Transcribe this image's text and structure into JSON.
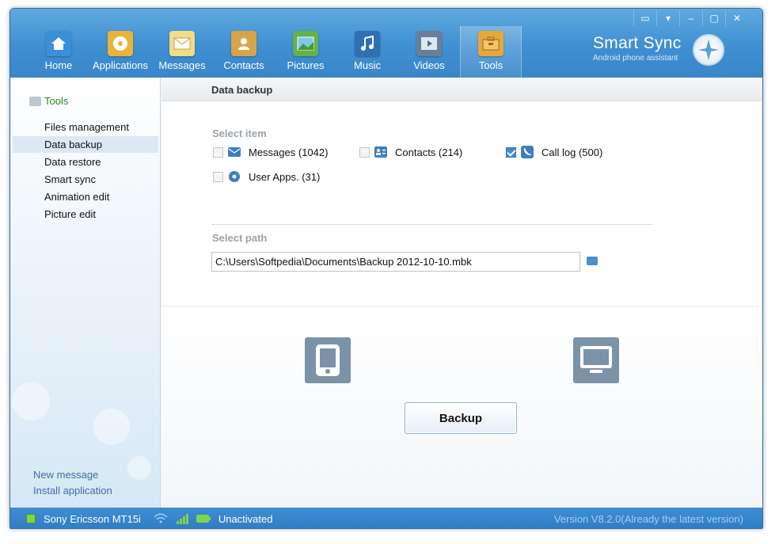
{
  "window": {
    "controls": [
      "message-icon",
      "menu-icon",
      "minimize-icon",
      "maximize-icon",
      "close-icon"
    ]
  },
  "nav": {
    "items": [
      {
        "label": "Home",
        "icon": "home-icon",
        "color": "#3a8fd6"
      },
      {
        "label": "Applications",
        "icon": "applications-icon",
        "color": "#e9b43a"
      },
      {
        "label": "Messages",
        "icon": "messages-icon",
        "color": "#f1dc8a"
      },
      {
        "label": "Contacts",
        "icon": "contacts-icon",
        "color": "#d9a34a"
      },
      {
        "label": "Pictures",
        "icon": "pictures-icon",
        "color": "#63b24a"
      },
      {
        "label": "Music",
        "icon": "music-icon",
        "color": "#2f6fb4"
      },
      {
        "label": "Videos",
        "icon": "videos-icon",
        "color": "#6a7f95"
      },
      {
        "label": "Tools",
        "icon": "tools-icon",
        "color": "#e6a83a"
      }
    ],
    "active": "Tools"
  },
  "brand": {
    "title": "Smart Sync",
    "subtitle": "Android phone assistant"
  },
  "sidebar": {
    "root": "Tools",
    "items": [
      "Files management",
      "Data backup",
      "Data restore",
      "Smart sync",
      "Animation edit",
      "Picture edit"
    ],
    "selected": "Data backup",
    "links": [
      "New message",
      "Install application"
    ]
  },
  "main": {
    "header": "Data backup",
    "select_item_label": "Select item",
    "options": [
      {
        "label": "Messages (1042)",
        "checked": false,
        "icon": "envelope-icon"
      },
      {
        "label": "Contacts (214)",
        "checked": false,
        "icon": "contact-card-icon"
      },
      {
        "label": "Call log (500)",
        "checked": true,
        "icon": "phone-icon"
      },
      {
        "label": "User  Apps. (31)",
        "checked": false,
        "icon": "app-disc-icon"
      }
    ],
    "select_path_label": "Select path",
    "path_value": "C:\\Users\\Softpedia\\Documents\\Backup 2012-10-10.mbk",
    "backup_label": "Backup"
  },
  "status": {
    "device": "Sony Ericsson MT15i",
    "activation": "Unactivated",
    "version": "Version V8.2.0(Already the latest version)"
  },
  "colors": {
    "accent": "#3f8fd2",
    "device_tile": "#7c92a6",
    "link": "#3a6ea8"
  }
}
